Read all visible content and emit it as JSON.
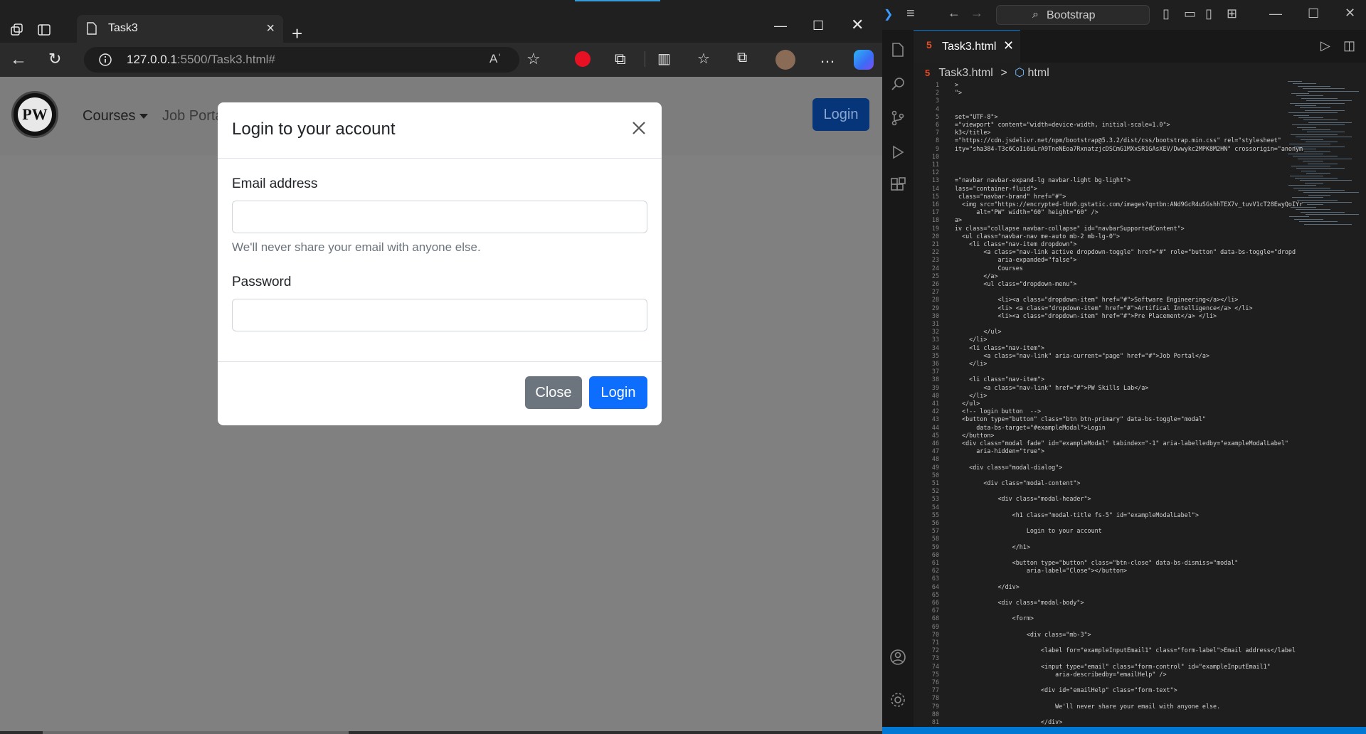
{
  "browser": {
    "tab_title": "Task3",
    "url_host": "127.0.0.1",
    "url_rest": ":5500/Task3.html#",
    "read_aloud_icon": "Aʾ"
  },
  "page": {
    "logo_text": "PW",
    "nav": {
      "courses": "Courses",
      "job_portal": "Job Porta",
      "login": "Login"
    }
  },
  "modal": {
    "title": "Login to your account",
    "email_label": "Email address",
    "email_value": "",
    "email_help": "We'll never share your email with anyone else.",
    "password_label": "Password",
    "password_value": "",
    "close_button": "Close",
    "login_button": "Login"
  },
  "vscode": {
    "search_text": "Bootstrap",
    "tab_name": "Task3.html",
    "breadcrumb_file": "Task3.html",
    "breadcrumb_sep": ">",
    "breadcrumb_node": "html",
    "html_icon": "5",
    "code_lines": [
      {
        "n": "1",
        "c": ">"
      },
      {
        "n": "2",
        "c": "\">"
      },
      {
        "n": "3",
        "c": ""
      },
      {
        "n": "4",
        "c": ""
      },
      {
        "n": "5",
        "c": "set=\"UTF-8\">"
      },
      {
        "n": "6",
        "c": "=\"viewport\" content=\"width=device-width, initial-scale=1.0\">"
      },
      {
        "n": "7",
        "c": "k3</title>"
      },
      {
        "n": "8",
        "c": "=\"https://cdn.jsdelivr.net/npm/bootstrap@5.3.2/dist/css/bootstrap.min.css\" rel=\"stylesheet\""
      },
      {
        "n": "9",
        "c": "ity=\"sha384-T3c6CoIi6uLrA9TneNEoa7RxnatzjcDSCmG1MXxSR1GAsXEV/Dwwykc2MPK8M2HN\" crossorigin=\"anonym"
      },
      {
        "n": "10",
        "c": ""
      },
      {
        "n": "11",
        "c": ""
      },
      {
        "n": "12",
        "c": ""
      },
      {
        "n": "13",
        "c": "=\"navbar navbar-expand-lg navbar-light bg-light\">"
      },
      {
        "n": "14",
        "c": "lass=\"container-fluid\">"
      },
      {
        "n": "15",
        "c": " class=\"navbar-brand\" href=\"#\">"
      },
      {
        "n": "16",
        "c": "  <img src=\"https://encrypted-tbn0.gstatic.com/images?q=tbn:ANd9GcR4uSGshhTEX7v_tuvV1cT28EwyQoIYr"
      },
      {
        "n": "17",
        "c": "      alt=\"PW\" width=\"60\" height=\"60\" />"
      },
      {
        "n": "18",
        "c": "a>"
      },
      {
        "n": "19",
        "c": "iv class=\"collapse navbar-collapse\" id=\"navbarSupportedContent\">"
      },
      {
        "n": "20",
        "c": "  <ul class=\"navbar-nav me-auto mb-2 mb-lg-0\">"
      },
      {
        "n": "21",
        "c": "    <li class=\"nav-item dropdown\">"
      },
      {
        "n": "22",
        "c": "        <a class=\"nav-link active dropdown-toggle\" href=\"#\" role=\"button\" data-bs-toggle=\"dropd"
      },
      {
        "n": "23",
        "c": "            aria-expanded=\"false\">"
      },
      {
        "n": "24",
        "c": "            Courses"
      },
      {
        "n": "25",
        "c": "        </a>"
      },
      {
        "n": "26",
        "c": "        <ul class=\"dropdown-menu\">"
      },
      {
        "n": "27",
        "c": ""
      },
      {
        "n": "28",
        "c": "            <li><a class=\"dropdown-item\" href=\"#\">Software Engineering</a></li>"
      },
      {
        "n": "29",
        "c": "            <li> <a class=\"dropdown-item\" href=\"#\">Artifical Intelligence</a> </li>"
      },
      {
        "n": "30",
        "c": "            <li><a class=\"dropdown-item\" href=\"#\">Pre Placement</a> </li>"
      },
      {
        "n": "31",
        "c": ""
      },
      {
        "n": "32",
        "c": "        </ul>"
      },
      {
        "n": "33",
        "c": "    </li>"
      },
      {
        "n": "34",
        "c": "    <li class=\"nav-item\">"
      },
      {
        "n": "35",
        "c": "        <a class=\"nav-link\" aria-current=\"page\" href=\"#\">Job Portal</a>"
      },
      {
        "n": "36",
        "c": "    </li>"
      },
      {
        "n": "37",
        "c": ""
      },
      {
        "n": "38",
        "c": "    <li class=\"nav-item\">"
      },
      {
        "n": "39",
        "c": "        <a class=\"nav-link\" href=\"#\">PW Skills Lab</a>"
      },
      {
        "n": "40",
        "c": "    </li>"
      },
      {
        "n": "41",
        "c": "  </ul>"
      },
      {
        "n": "42",
        "c": "  <!-- login button  -->"
      },
      {
        "n": "43",
        "c": "  <button type=\"button\" class=\"btn btn-primary\" data-bs-toggle=\"modal\""
      },
      {
        "n": "44",
        "c": "      data-bs-target=\"#exampleModal\">Login"
      },
      {
        "n": "45",
        "c": "  </button>"
      },
      {
        "n": "46",
        "c": "  <div class=\"modal fade\" id=\"exampleModal\" tabindex=\"-1\" aria-labelledby=\"exampleModalLabel\""
      },
      {
        "n": "47",
        "c": "      aria-hidden=\"true\">"
      },
      {
        "n": "48",
        "c": ""
      },
      {
        "n": "49",
        "c": "    <div class=\"modal-dialog\">"
      },
      {
        "n": "50",
        "c": ""
      },
      {
        "n": "51",
        "c": "        <div class=\"modal-content\">"
      },
      {
        "n": "52",
        "c": ""
      },
      {
        "n": "53",
        "c": "            <div class=\"modal-header\">"
      },
      {
        "n": "54",
        "c": ""
      },
      {
        "n": "55",
        "c": "                <h1 class=\"modal-title fs-5\" id=\"exampleModalLabel\">"
      },
      {
        "n": "56",
        "c": ""
      },
      {
        "n": "57",
        "c": "                    Login to your account"
      },
      {
        "n": "58",
        "c": ""
      },
      {
        "n": "59",
        "c": "                </h1>"
      },
      {
        "n": "60",
        "c": ""
      },
      {
        "n": "61",
        "c": "                <button type=\"button\" class=\"btn-close\" data-bs-dismiss=\"modal\""
      },
      {
        "n": "62",
        "c": "                    aria-label=\"Close\"></button>"
      },
      {
        "n": "63",
        "c": ""
      },
      {
        "n": "64",
        "c": "            </div>"
      },
      {
        "n": "65",
        "c": ""
      },
      {
        "n": "66",
        "c": "            <div class=\"modal-body\">"
      },
      {
        "n": "67",
        "c": ""
      },
      {
        "n": "68",
        "c": "                <form>"
      },
      {
        "n": "69",
        "c": ""
      },
      {
        "n": "70",
        "c": "                    <div class=\"mb-3\">"
      },
      {
        "n": "71",
        "c": ""
      },
      {
        "n": "72",
        "c": "                        <label for=\"exampleInputEmail1\" class=\"form-label\">Email address</label"
      },
      {
        "n": "73",
        "c": ""
      },
      {
        "n": "74",
        "c": "                        <input type=\"email\" class=\"form-control\" id=\"exampleInputEmail1\""
      },
      {
        "n": "75",
        "c": "                            aria-describedby=\"emailHelp\" />"
      },
      {
        "n": "76",
        "c": ""
      },
      {
        "n": "77",
        "c": "                        <div id=\"emailHelp\" class=\"form-text\">"
      },
      {
        "n": "78",
        "c": ""
      },
      {
        "n": "79",
        "c": "                            We'll never share your email with anyone else."
      },
      {
        "n": "80",
        "c": ""
      },
      {
        "n": "81",
        "c": "                        </div>"
      }
    ]
  }
}
